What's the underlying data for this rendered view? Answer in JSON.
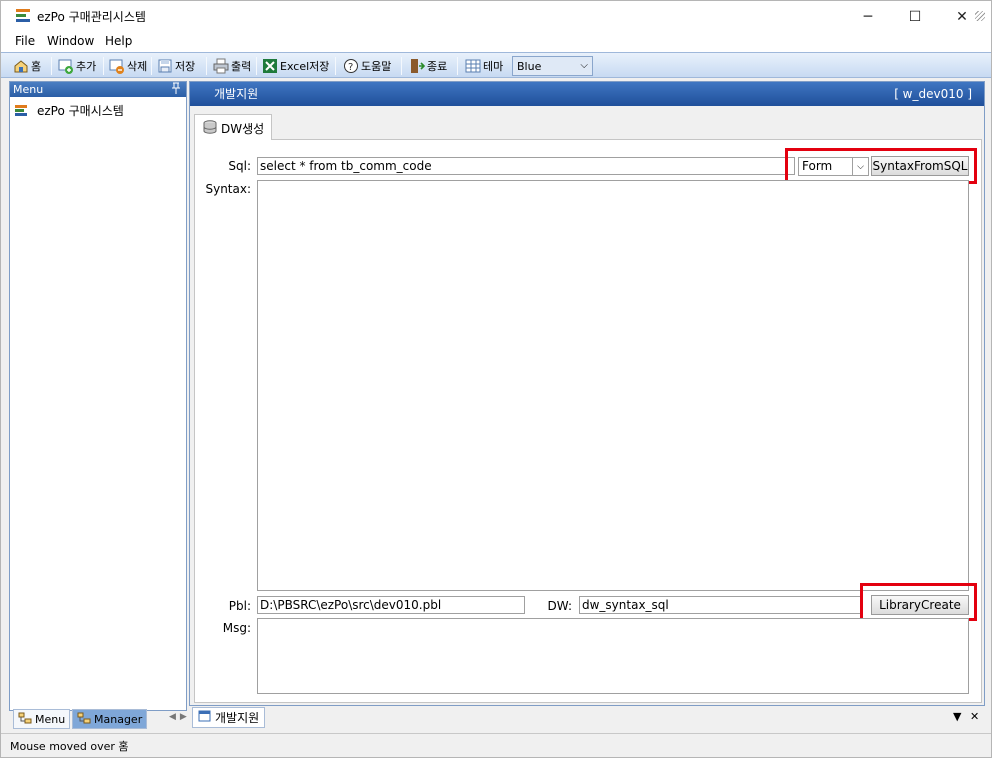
{
  "window": {
    "title": "ezPo 구매관리시스템",
    "minimize": "─",
    "maximize": "☐",
    "close": "✕"
  },
  "menubar": [
    "File",
    "Window",
    "Help"
  ],
  "toolbar": {
    "home": "홈",
    "add": "추가",
    "delete": "삭제",
    "save": "저장",
    "print": "출력",
    "excel_save": "Excel저장",
    "help": "도움말",
    "exit": "종료",
    "theme": "테마",
    "theme_value": "Blue"
  },
  "left_panel": {
    "header": "Menu",
    "pin": "ᵖ",
    "tree_root": "ezPo 구매시스템"
  },
  "left_tabs": {
    "menu": "Menu",
    "manager": "Manager"
  },
  "main": {
    "header_title": "개발지원",
    "window_code": "[  w_dev010  ]",
    "tab": "DW생성",
    "sql_label": "Sql:",
    "sql_value": "select * from tb_comm_code",
    "style_value": "Form",
    "syntax_button": "SyntaxFromSQL",
    "syntax_label": "Syntax:",
    "pbl_label": "Pbl:",
    "pbl_value": "D:\\PBSRC\\ezPo\\src\\dev010.pbl",
    "dw_label": "DW:",
    "dw_value": "dw_syntax_sql",
    "library_button": "LibraryCreate",
    "msg_label": "Msg:"
  },
  "bottom_tab": "개발지원",
  "status": "Mouse moved over 홈",
  "colors": {
    "header_blue": "#2b5ea6",
    "highlight_red": "#e3000f",
    "toolbar_blue": "#c7daf2"
  }
}
